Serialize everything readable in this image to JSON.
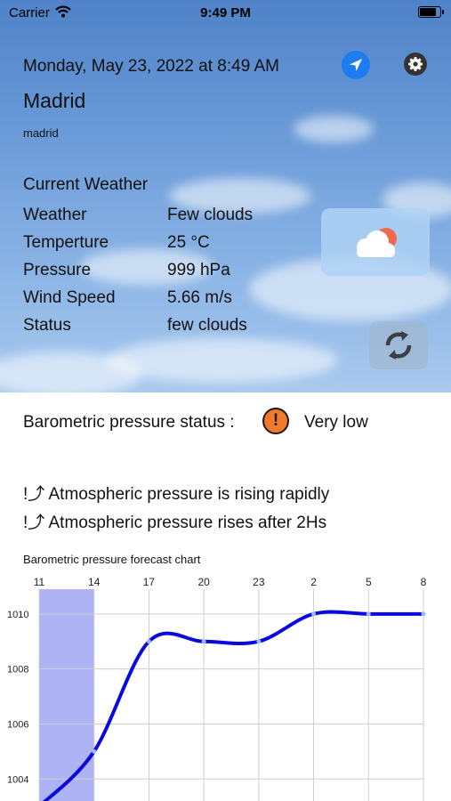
{
  "status_bar": {
    "carrier": "Carrier",
    "time": "9:49 PM"
  },
  "header": {
    "datetime": "Monday, May 23, 2022 at 8:49 AM",
    "city": "Madrid",
    "city_subtitle": "madrid",
    "location_icon": "location-arrow-icon",
    "settings_icon": "gear-icon"
  },
  "current_weather": {
    "title": "Current Weather",
    "rows": [
      {
        "label": "Weather",
        "value": "Few clouds"
      },
      {
        "label": "Temperture",
        "value": "25 °C"
      },
      {
        "label": "Pressure",
        "value": "999 hPa"
      },
      {
        "label": "Wind Speed",
        "value": "5.66 m/s"
      },
      {
        "label": "Status",
        "value": "few clouds"
      }
    ],
    "weather_icon": "sun-behind-cloud-icon",
    "refresh_icon": "refresh-icon"
  },
  "barometer": {
    "label": "Barometric pressure status :",
    "status_icon": "exclamation-circle-icon",
    "status_color": "#f07a2a",
    "status": "Very low",
    "trends": [
      "!⤴  Atmospheric pressure is rising rapidly",
      "!⤴ Atmospheric pressure rises after 2Hs"
    ]
  },
  "chart_data": {
    "type": "line",
    "title": "Barometric pressure forecast chart",
    "x_ticks": [
      "11",
      "14",
      "17",
      "20",
      "23",
      "2",
      "5",
      "8"
    ],
    "y_ticks": [
      "1010",
      "1008",
      "1006",
      "1004"
    ],
    "ylim": [
      1003.2,
      1010.9
    ],
    "highlight_range": [
      "11",
      "14"
    ],
    "highlight_color": "#aeb3f5",
    "line_color": "#0a0adf",
    "grid": true,
    "series": [
      {
        "x": [
          11,
          14,
          17,
          20,
          23,
          26,
          29,
          32
        ],
        "values": [
          1003,
          1005,
          1009,
          1009,
          1009,
          1010,
          1010,
          1010
        ]
      }
    ]
  }
}
